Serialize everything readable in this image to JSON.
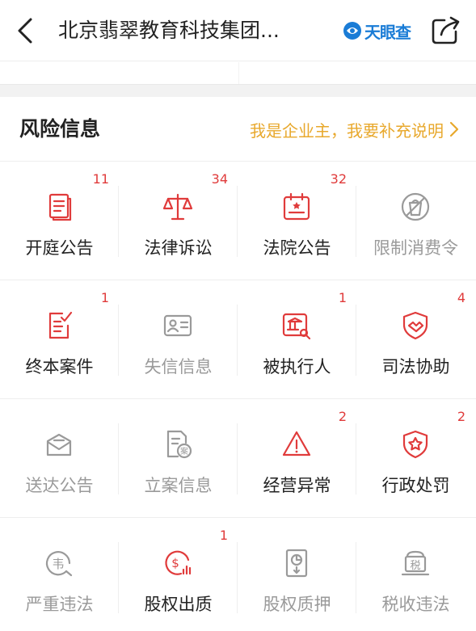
{
  "header": {
    "title": "北京翡翠教育科技集团...",
    "brand_name": "天眼查",
    "back_icon": "chevron-left-icon",
    "share_icon": "share-icon"
  },
  "section": {
    "title": "风险信息",
    "owner_link": "我是企业主，我要补充说明"
  },
  "colors": {
    "accent_red": "#e03b3b",
    "link_gold": "#e8a82c",
    "brand_blue": "#1a7cd6",
    "inactive_gray": "#9a9a9a"
  },
  "items": [
    {
      "label": "开庭公告",
      "count": "11",
      "active": true,
      "icon": "document-icon"
    },
    {
      "label": "法律诉讼",
      "count": "34",
      "active": true,
      "icon": "scales-icon"
    },
    {
      "label": "法院公告",
      "count": "32",
      "active": true,
      "icon": "calendar-notice-icon"
    },
    {
      "label": "限制消费令",
      "count": "",
      "active": false,
      "icon": "no-bag-icon"
    },
    {
      "label": "终本案件",
      "count": "1",
      "active": true,
      "icon": "checked-doc-icon"
    },
    {
      "label": "失信信息",
      "count": "",
      "active": false,
      "icon": "id-card-icon"
    },
    {
      "label": "被执行人",
      "count": "1",
      "active": true,
      "icon": "court-search-icon"
    },
    {
      "label": "司法协助",
      "count": "4",
      "active": true,
      "icon": "shield-handshake-icon"
    },
    {
      "label": "送达公告",
      "count": "",
      "active": false,
      "icon": "envelope-icon"
    },
    {
      "label": "立案信息",
      "count": "",
      "active": false,
      "icon": "case-file-icon"
    },
    {
      "label": "经营异常",
      "count": "2",
      "active": true,
      "icon": "warning-icon"
    },
    {
      "label": "行政处罚",
      "count": "2",
      "active": true,
      "icon": "shield-star-icon"
    },
    {
      "label": "严重违法",
      "count": "",
      "active": false,
      "icon": "violation-icon"
    },
    {
      "label": "股权出质",
      "count": "1",
      "active": true,
      "icon": "equity-pledge-icon"
    },
    {
      "label": "股权质押",
      "count": "",
      "active": false,
      "icon": "pie-doc-icon"
    },
    {
      "label": "税收违法",
      "count": "",
      "active": false,
      "icon": "tax-icon"
    }
  ]
}
